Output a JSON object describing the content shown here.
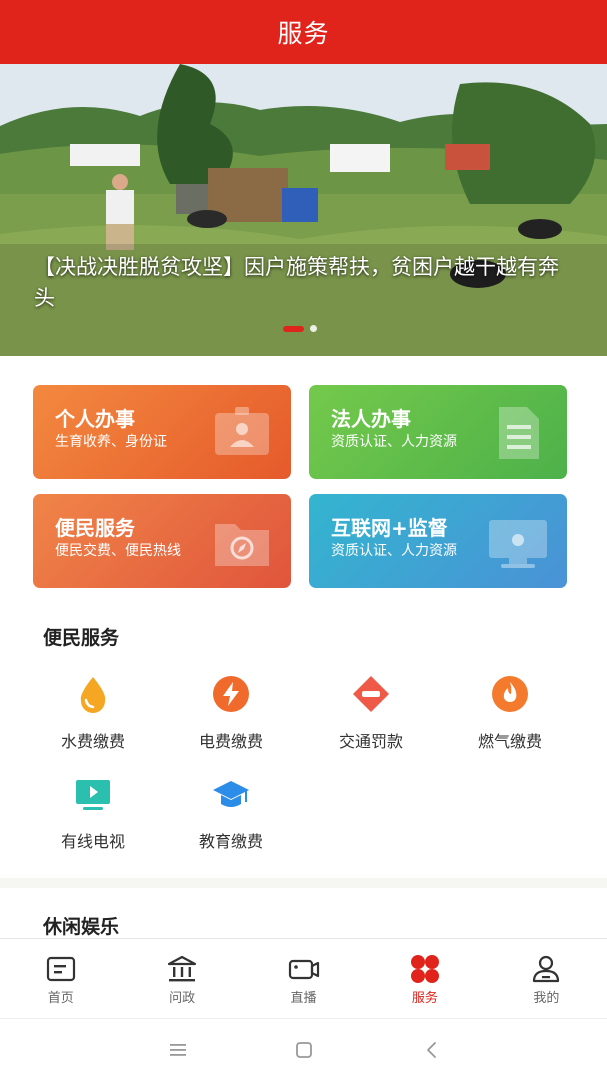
{
  "header": {
    "title": "服务"
  },
  "banner": {
    "caption": "【决战决胜脱贫攻坚】因户施策帮扶，贫困户越干越有奔头",
    "slide_count": 2,
    "active_slide": 1
  },
  "cards": [
    {
      "title": "个人办事",
      "subtitle": "生育收养、身份证",
      "icon": "id-card-icon"
    },
    {
      "title": "法人办事",
      "subtitle": "资质认证、人力资源",
      "icon": "document-icon"
    },
    {
      "title": "便民服务",
      "subtitle": "便民交费、便民热线",
      "icon": "folder-compass-icon"
    },
    {
      "title": "互联网+监督",
      "subtitle": "资质认证、人力资源",
      "icon": "monitor-icon"
    }
  ],
  "convenience": {
    "title": "便民服务",
    "items": [
      {
        "label": "水费缴费",
        "icon": "water-drop-icon",
        "color": "#f5a623"
      },
      {
        "label": "电费缴费",
        "icon": "lightning-icon",
        "color": "#f06a2b"
      },
      {
        "label": "交通罚款",
        "icon": "no-entry-icon",
        "color": "#ef5a48"
      },
      {
        "label": "燃气缴费",
        "icon": "flame-icon",
        "color": "#f47b2e"
      },
      {
        "label": "有线电视",
        "icon": "tv-play-icon",
        "color": "#2bbfb0"
      },
      {
        "label": "教育缴费",
        "icon": "graduation-cap-icon",
        "color": "#2c8de8"
      }
    ]
  },
  "leisure": {
    "title": "休闲娱乐"
  },
  "tabbar": {
    "items": [
      {
        "label": "首页",
        "icon": "home-doc-icon"
      },
      {
        "label": "问政",
        "icon": "government-building-icon"
      },
      {
        "label": "直播",
        "icon": "video-camera-icon"
      },
      {
        "label": "服务",
        "icon": "four-dots-icon"
      },
      {
        "label": "我的",
        "icon": "user-profile-icon"
      }
    ],
    "active": "服务"
  },
  "system_nav": {
    "icons": [
      "menu-icon",
      "home-square-icon",
      "back-chevron-icon"
    ]
  },
  "colors": {
    "brand": "#e0241c",
    "tab_active": "#e0241c",
    "tab_inactive": "#666666"
  }
}
